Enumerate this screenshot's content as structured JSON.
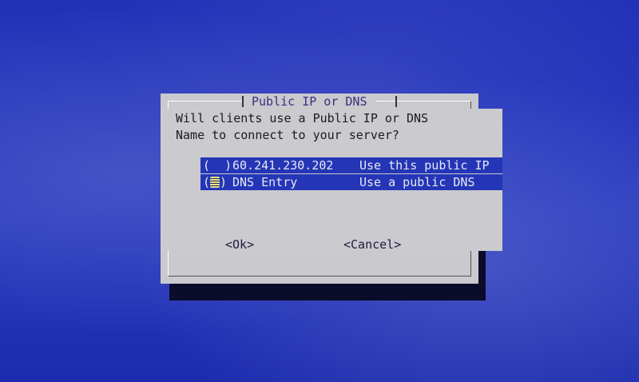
{
  "dialog": {
    "title": "Public IP or DNS",
    "prompt": "Will clients use a Public IP or DNS\nName to connect to your server?"
  },
  "options": [
    {
      "radio_open": "( ",
      "radio_close": " )",
      "selected": false,
      "value": "60.241.230.202",
      "description": "Use this public IP"
    },
    {
      "radio_open": "(",
      "radio_close": ")",
      "selected": true,
      "value": "DNS Entry",
      "description": "Use a public DNS"
    }
  ],
  "buttons": {
    "ok": "<Ok>",
    "cancel": "<Cancel>"
  },
  "colors": {
    "screen_bg": "#1f2fb8",
    "dialog_bg": "#c9c9ce",
    "highlight_bg": "#2436b6",
    "highlight_fg": "#e8e8f4",
    "shadow": "#0b0b2a"
  }
}
